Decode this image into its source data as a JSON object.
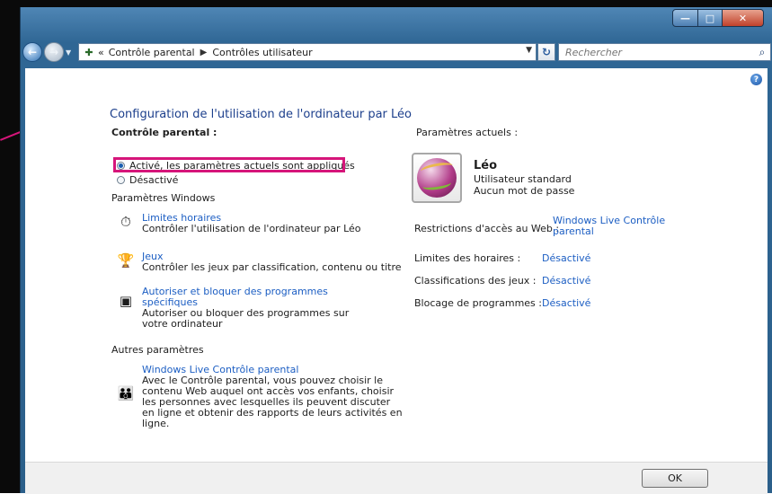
{
  "window": {
    "caption_buttons": {
      "minimize": "—",
      "maximize": "□",
      "close": "✕"
    }
  },
  "navigation": {
    "breadcrumb": [
      "Contrôle parental",
      "Contrôles utilisateur"
    ],
    "breadcrumb_overflow": "«",
    "search_placeholder": "Rechercher"
  },
  "page": {
    "title": "Configuration de l'utilisation de l'ordinateur par Léo",
    "parental_control_label": "Contrôle parental :",
    "radio_on": "Activé, les paramètres actuels sont appliqués",
    "radio_off": "Désactivé",
    "windows_settings_heading": "Paramètres Windows",
    "items": [
      {
        "icon": "stopwatch-icon",
        "link": "Limites horaires",
        "desc": "Contrôler l'utilisation de l'ordinateur par Léo"
      },
      {
        "icon": "trophy-icon",
        "link": "Jeux",
        "desc": "Contrôler les jeux par classification, contenu ou titre"
      },
      {
        "icon": "program-block-icon",
        "link": "Autoriser et bloquer des programmes spécifiques",
        "desc": "Autoriser ou bloquer des programmes sur votre ordinateur"
      }
    ],
    "other_settings_heading": "Autres paramètres",
    "live": {
      "icon": "windows-live-family-icon",
      "link": "Windows Live Contrôle parental",
      "desc": "Avec le Contrôle parental, vous pouvez choisir le contenu Web auquel ont accès vos enfants, choisir les personnes avec lesquelles ils peuvent discuter en ligne et obtenir des rapports de leurs activités en ligne."
    }
  },
  "current": {
    "heading": "Paramètres actuels :",
    "user_name": "Léo",
    "user_type": "Utilisateur standard",
    "password": "Aucun mot de passe",
    "web_label": "Restrictions d'accès au Web :",
    "web_value": "Windows Live Contrôle parental",
    "time_label": "Limites des horaires :",
    "time_value": "Désactivé",
    "games_label": "Classifications des jeux :",
    "games_value": "Désactivé",
    "programs_label": "Blocage de programmes :",
    "programs_value": "Désactivé"
  },
  "footer": {
    "ok": "OK"
  },
  "colors": {
    "highlight": "#d6157a",
    "link": "#1c5ec3",
    "title": "#1c3f8c"
  }
}
